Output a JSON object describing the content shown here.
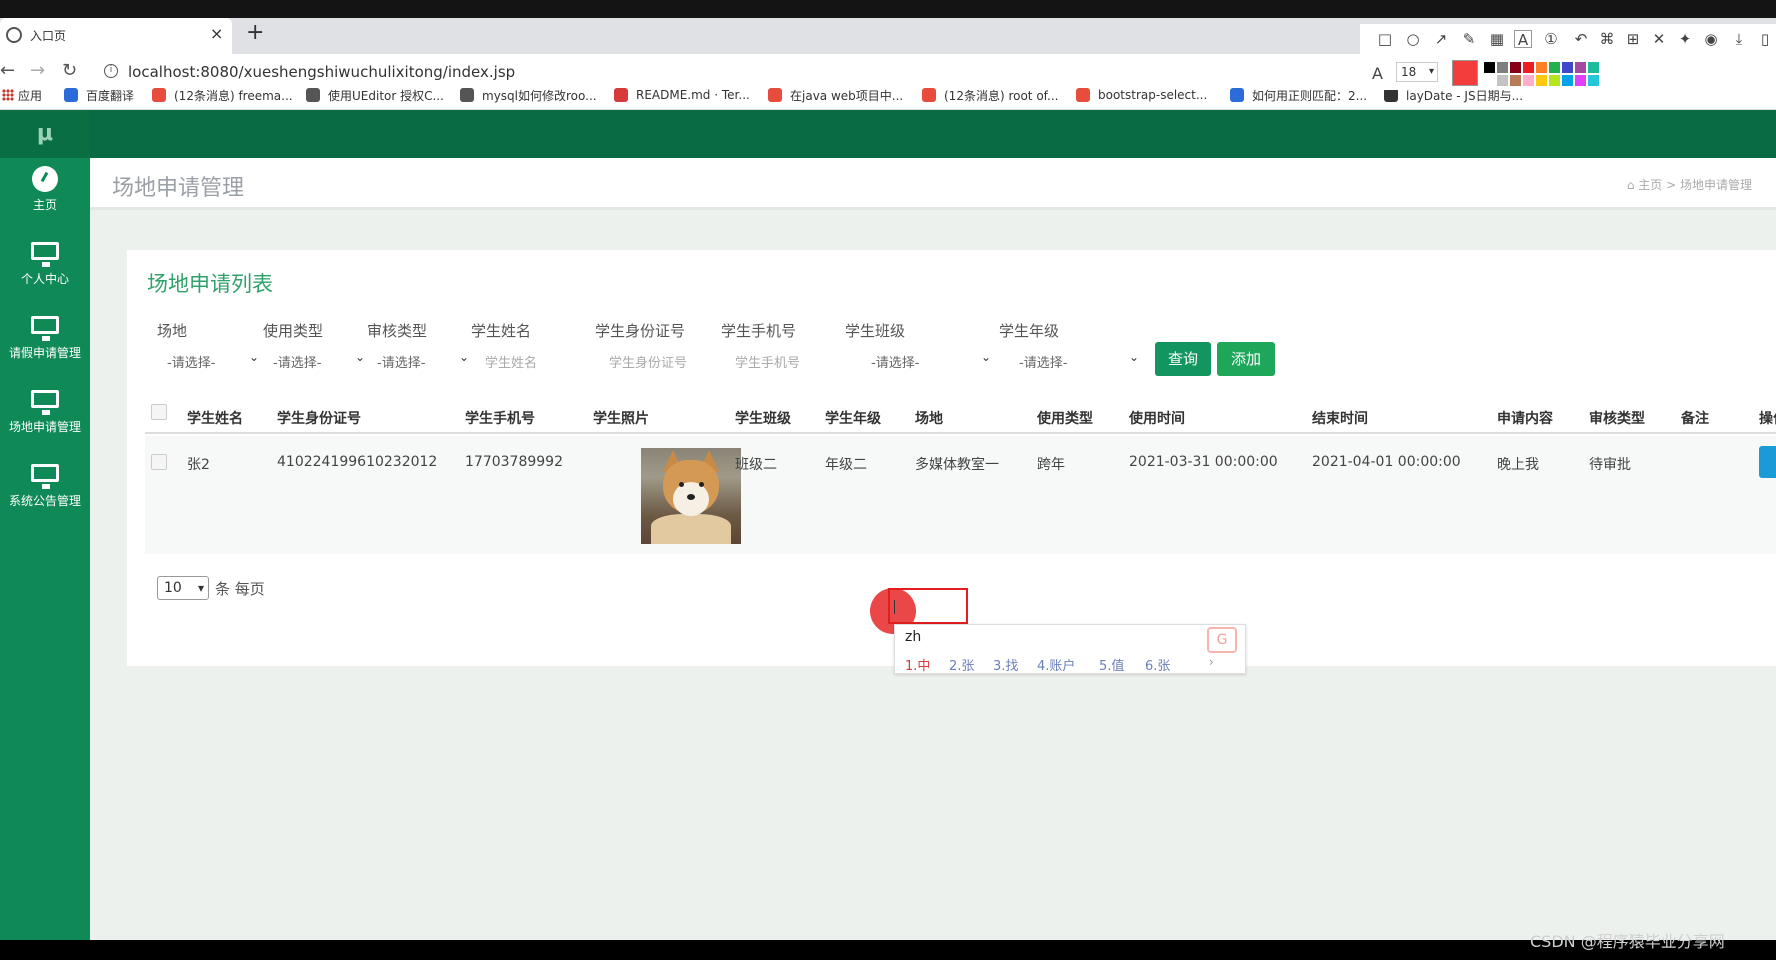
{
  "browser": {
    "tab_title": "入口页",
    "tab_close": "×",
    "new_tab": "+",
    "url": "localhost:8080/xueshengshiwuchulixitong/index.jsp",
    "bookmarks": [
      {
        "label": "应用",
        "color": "#c0392b"
      },
      {
        "label": "百度翻译",
        "color": "#2b6cd9"
      },
      {
        "label": "(12条消息) freema...",
        "color": "#e74c3c"
      },
      {
        "label": "使用UEditor 授权C...",
        "color": "#555555"
      },
      {
        "label": "mysql如何修改roo...",
        "color": "#555555"
      },
      {
        "label": "README.md · Ter...",
        "color": "#d63a3a"
      },
      {
        "label": "在java web项目中...",
        "color": "#e74c3c"
      },
      {
        "label": "(12条消息) root of...",
        "color": "#e74c3c"
      },
      {
        "label": "bootstrap-select...",
        "color": "#e74c3c"
      },
      {
        "label": "如何用正则匹配：2...",
        "color": "#2b6cd9"
      },
      {
        "label": "layDate - JS日期与...",
        "color": "#333333"
      }
    ]
  },
  "snap_toolbar": {
    "font_size": "18",
    "current_color": "#f33c3c",
    "swatches": [
      "#000000",
      "#7f7f7f",
      "#880015",
      "#ed1c24",
      "#ff7f27",
      "#22b14c",
      "#3f48cc",
      "#a349a4",
      "#1abc9c",
      "#ffffff",
      "#c3c3c3",
      "#b97a57",
      "#ffaec9",
      "#ffc90e",
      "#b5e61d",
      "#00a2e8",
      "#e040fb",
      "#26c6da"
    ]
  },
  "sidebar": {
    "logo": "μ",
    "items": [
      {
        "label": "主页",
        "icon": "dashboard-icon"
      },
      {
        "label": "个人中心",
        "icon": "monitor-icon"
      },
      {
        "label": "请假申请管理",
        "icon": "monitor-icon"
      },
      {
        "label": "场地申请管理",
        "icon": "monitor-icon"
      },
      {
        "label": "系统公告管理",
        "icon": "monitor-icon"
      }
    ]
  },
  "page": {
    "title": "场地申请管理",
    "breadcrumb_home": "主页",
    "breadcrumb_current": "场地申请管理"
  },
  "card": {
    "title": "场地申请列表"
  },
  "filters": {
    "labels": [
      "场地",
      "使用类型",
      "审核类型",
      "学生姓名",
      "学生身份证号",
      "学生手机号",
      "学生班级",
      "学生年级"
    ],
    "select_placeholder": "-请选择-",
    "name_placeholder": "学生姓名",
    "id_placeholder": "学生身份证号",
    "phone_placeholder": "学生手机号",
    "query_label": "查询",
    "add_label": "添加"
  },
  "table": {
    "headers": [
      "学生姓名",
      "学生身份证号",
      "学生手机号",
      "学生照片",
      "学生班级",
      "学生年级",
      "场地",
      "使用类型",
      "使用时间",
      "结束时间",
      "申请内容",
      "审核类型",
      "备注",
      "操作"
    ],
    "rows": [
      {
        "name": "张2",
        "id_number": "410224199610232012",
        "phone": "17703789992",
        "class": "班级二",
        "grade": "年级二",
        "venue": "多媒体教室一",
        "use_type": "跨年",
        "start_time": "2021-03-31 00:00:00",
        "end_time": "2021-04-01 00:00:00",
        "content": "晚上我",
        "review": "待审批",
        "note": ""
      }
    ]
  },
  "pagination": {
    "page_size": "10",
    "per_page_label": "条 每页"
  },
  "ime": {
    "composition": "zh",
    "candidates": [
      "1.中",
      "2.张",
      "3.找",
      "4.账户",
      "5.值",
      "6.张"
    ],
    "more": "›"
  },
  "watermark": "CSDN @程序猿毕业分享网"
}
